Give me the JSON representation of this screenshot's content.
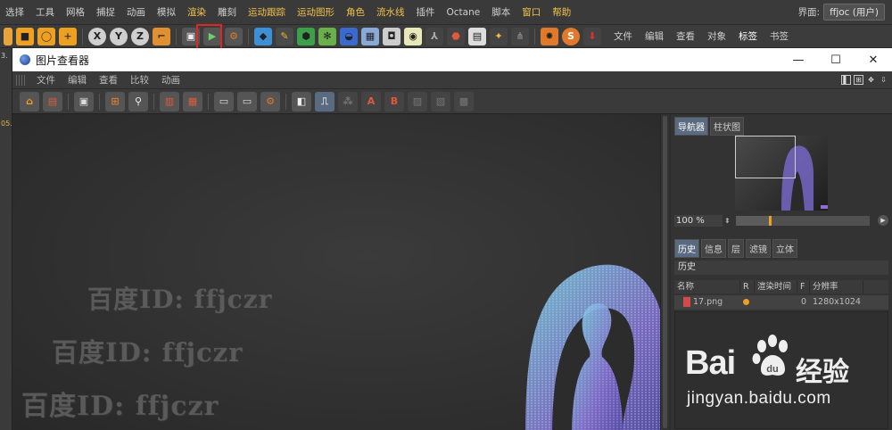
{
  "c4d_menubar": {
    "items": [
      "选择",
      "工具",
      "网格",
      "捕捉",
      "动画",
      "模拟",
      "渲染",
      "雕刻",
      "运动跟踪",
      "运动图形",
      "角色",
      "流水线",
      "插件",
      "Octane",
      "脚本",
      "窗口",
      "帮助"
    ],
    "layout_label": "界面:",
    "layout_value": "ffjoc (用户)"
  },
  "c4d_toolbar": {
    "menu": [
      "文件",
      "编辑",
      "查看",
      "对象",
      "标签",
      "书签"
    ]
  },
  "picture_viewer": {
    "title": "图片查看器",
    "window_buttons": {
      "minimize": "—",
      "maximize": "☐",
      "close": "✕"
    },
    "menu": [
      "文件",
      "编辑",
      "查看",
      "比较",
      "动画"
    ],
    "nav_tabs": [
      "导航器",
      "柱状图"
    ],
    "zoom": {
      "value": "100 %",
      "level_fraction": 0.25
    },
    "history_tabs": [
      "历史",
      "信息",
      "层",
      "滤镜",
      "立体"
    ],
    "history_title": "历史",
    "history_columns": [
      "名称",
      "R",
      "渲染时间",
      "F",
      "分辨率"
    ],
    "history_rows": [
      {
        "name": "17.png",
        "render_time": "0",
        "resolution": "1280x1024"
      }
    ]
  },
  "watermarks": [
    "百度ID: ffjczr",
    "百度ID: ffjczr",
    "百度ID: ffjczr"
  ],
  "baidu": {
    "logo": "Bai",
    "logo_cn": "经验",
    "url": "jingyan.baidu.com"
  },
  "left_strip": {
    "top_label": "3.",
    "mid_label": "05."
  }
}
